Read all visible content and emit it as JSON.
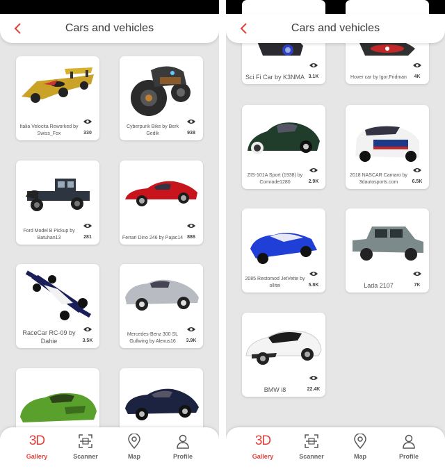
{
  "app": {
    "title": "Cars and vehicles"
  },
  "colors": {
    "accent": "#e0413b",
    "background": "#e6e6e6",
    "statusbar": "#000000"
  },
  "icons": {
    "back": "chevron-left-icon",
    "views": "eye-icon",
    "gallery": "3d-text-icon",
    "scanner": "scanner-frame-icon",
    "map": "map-pin-icon",
    "profile": "person-icon"
  },
  "left_screen": {
    "cards": [
      {
        "name": "Italia Velocita Reworked by Swiss_Fox",
        "views": "330"
      },
      {
        "name": "Cyberpunk Bike by Berk Gedik",
        "views": "938"
      },
      {
        "name": "Ford Model B Pickup by Batuhan13",
        "views": "281"
      },
      {
        "name": "Ferrari Dino 246 by Pajac14",
        "views": "886"
      },
      {
        "name": "RaceCar RC-09 by Dahie",
        "views": "3.5K"
      },
      {
        "name": "Mercedes-Benz 300 SL Gullwing by Alexus16",
        "views": "3.9K"
      },
      {
        "name": "",
        "views": ""
      },
      {
        "name": "",
        "views": ""
      }
    ]
  },
  "right_screen": {
    "cards": [
      {
        "name": "Sci Fi Car by K3NMA",
        "views": "3.1K"
      },
      {
        "name": "Hover car by Igor.Fridman",
        "views": "4K"
      },
      {
        "name": "ZIS-101A Sport (1938) by Comrade1280",
        "views": "2.9K"
      },
      {
        "name": "2018 NASCAR Camaro by 3dautosports.com",
        "views": "6.5K"
      },
      {
        "name": "2085 Restomod JetVette by ollitei",
        "views": "5.8K"
      },
      {
        "name": "Lada 2107",
        "views": "7K"
      },
      {
        "name": "BMW i8",
        "views": "22.4K"
      }
    ]
  },
  "tabs": [
    {
      "label": "Gallery",
      "icon": "3d-text-icon",
      "glyph": "3D",
      "active": true
    },
    {
      "label": "Scanner",
      "icon": "scanner-frame-icon",
      "active": false
    },
    {
      "label": "Map",
      "icon": "map-pin-icon",
      "active": false
    },
    {
      "label": "Profile",
      "icon": "person-icon",
      "active": false
    }
  ]
}
